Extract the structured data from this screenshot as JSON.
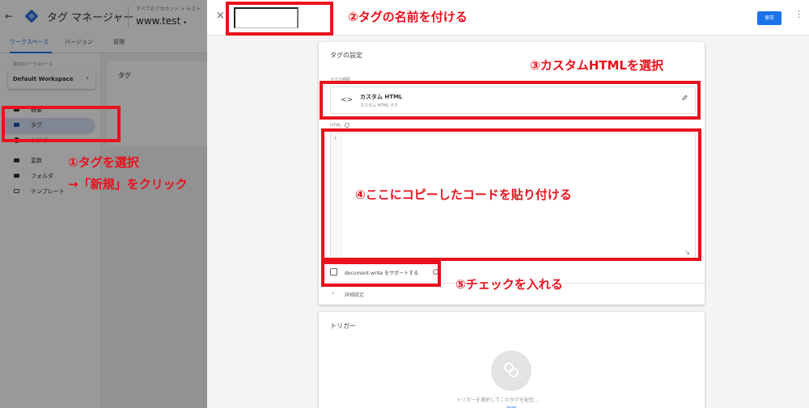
{
  "left_app": {
    "app_title": "タグ マネージャー",
    "account_path": "すべてのアカウント > テスト",
    "container_name": "www.test",
    "container_caret": "▾",
    "tabs": [
      {
        "label": "ワークスペース",
        "active": true
      },
      {
        "label": "バージョン",
        "active": false
      },
      {
        "label": "管理",
        "active": false
      }
    ],
    "workspace_label": "現在のワークスペース",
    "workspace_name": "Default Workspace",
    "nav_items": [
      {
        "label": "概要",
        "icon": "overview-icon"
      },
      {
        "label": "タグ",
        "icon": "tag-icon",
        "selected": true
      },
      {
        "label": "トリガー",
        "icon": "trigger-icon"
      },
      {
        "label": "変数",
        "icon": "variables-icon"
      },
      {
        "label": "フォルダ",
        "icon": "folder-icon"
      },
      {
        "label": "テンプレート",
        "icon": "template-icon"
      }
    ],
    "main_card_title": "タグ"
  },
  "editor": {
    "close_icon": "×",
    "tag_name_value": "",
    "save_label": "保存",
    "more_icon": "⋮",
    "config_title": "タグの設定",
    "tag_type_label": "タグの種類",
    "tag_type_name": "カスタム HTML",
    "tag_type_sub": "カスタム HTML タグ",
    "tag_type_icon": "<>",
    "html_label": "HTML",
    "code_line_number": "1",
    "document_write_label": "document.write をサポートする",
    "advanced_label": "詳細設定",
    "advanced_chevron": "›",
    "trigger_title": "トリガー",
    "trigger_hint": "トリガーを選択してこのタグを配信...",
    "trigger_link": "詳細"
  },
  "annotations": {
    "step1_line1": "①タグを選択",
    "step1_line2": "→「新規」をクリック",
    "step2": "②タグの名前を付ける",
    "step3": "③カスタムHTMLを選択",
    "step4": "④ここにコピーしたコードを貼り付ける",
    "step5": "⑤チェックを入れる",
    "color": "#e8111d"
  },
  "colors": {
    "accent": "#1a73e8",
    "selected_nav": "#d5e1f6",
    "annotation_red": "#e8111d"
  }
}
